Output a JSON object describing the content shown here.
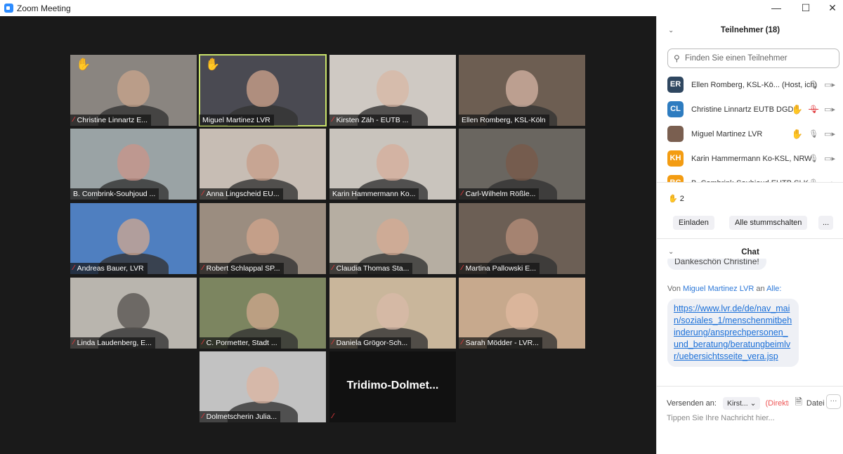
{
  "window": {
    "title": "Zoom Meeting",
    "controls": [
      "—",
      "☐",
      "✕"
    ]
  },
  "tiles": [
    {
      "name": "Christine Linnartz E...",
      "muted": true,
      "hand": true,
      "hand_color": "#a0714f",
      "bg": "#8a8580",
      "skin": "#c9a58c"
    },
    {
      "name": "Miguel Martinez LVR",
      "muted": false,
      "hand": true,
      "hand_color": "#f5c22b",
      "bg": "#4a4a52",
      "skin": "#d1a68e",
      "active": true
    },
    {
      "name": "Kirsten Zäh - EUTB ...",
      "muted": true,
      "bg": "#cfc9c3",
      "skin": "#d8b7a4"
    },
    {
      "name": "Ellen Romberg, KSL-Köln",
      "muted": false,
      "bg": "#6d5e52",
      "skin": "#d7b5a5"
    },
    {
      "name": "B. Combrink-Souhjoud ...",
      "muted": false,
      "bg": "#9aa3a5",
      "skin": "#c9948a"
    },
    {
      "name": "Anna Lingscheid EU...",
      "muted": true,
      "bg": "#c7bdb4",
      "skin": "#c79e88"
    },
    {
      "name": "Karin Hammermann Ko...",
      "muted": false,
      "bg": "#c9c4bd",
      "skin": "#d5ad9b"
    },
    {
      "name": "Carl-Wilhelm Rößle...",
      "muted": true,
      "bg": "#6a6660",
      "skin": "#7a5a48"
    },
    {
      "name": "Andreas Bauer, LVR",
      "muted": true,
      "bg": "#4f7fc0",
      "skin": "#d2a890"
    },
    {
      "name": "Robert Schlappal SP...",
      "muted": true,
      "bg": "#9b8d80",
      "skin": "#d2a58c"
    },
    {
      "name": "Claudia Thomas Sta...",
      "muted": true,
      "bg": "#b6aea2",
      "skin": "#d5aa92"
    },
    {
      "name": "Martina Pallowski E...",
      "muted": true,
      "bg": "#6c5f55",
      "skin": "#b88f7b"
    },
    {
      "name": "Linda Laudenberg, E...",
      "muted": true,
      "bg": "#b9b5ae",
      "skin": "#54504c"
    },
    {
      "name": "C. Pormetter, Stadt ...",
      "muted": true,
      "bg": "#7c8560",
      "skin": "#d0a88e"
    },
    {
      "name": "Daniela Grögor-Sch...",
      "muted": true,
      "bg": "#c9b69b",
      "skin": "#d8b9a8"
    },
    {
      "name": "Sarah Mödder - LVR...",
      "muted": true,
      "bg": "#c7a98d",
      "skin": "#e0b9a0"
    },
    {
      "name": "Dolmetscherin Julia...",
      "muted": true,
      "bg": "#c2c2c2",
      "skin": "#dcb4a0"
    },
    {
      "name": "",
      "big_name": "Tridimo-Dolmet...",
      "muted": true,
      "bg": "#111111"
    }
  ],
  "participants": {
    "title": "Teilnehmer (18)",
    "search_placeholder": "Finden Sie einen Teilnehmer",
    "list": [
      {
        "initials": "ER",
        "color": "#2f4760",
        "name": "Ellen Romberg, KSL-Kö... (Host, ich)",
        "hand": "",
        "mic": "🎙",
        "mic_muted": false
      },
      {
        "initials": "CL",
        "color": "#2e7cc0",
        "name": "Christine Linnartz EUTB DGD",
        "hand": "✋",
        "hand_color": "#a0714f",
        "mic": "🎙",
        "mic_muted": true
      },
      {
        "initials": "",
        "color": "#7a5f50",
        "name": "Miguel Martinez LVR",
        "hand": "✋",
        "hand_color": "#f5c22b",
        "mic": "🎙",
        "mic_muted": false
      },
      {
        "initials": "KH",
        "color": "#f39c12",
        "name": "Karin Hammermann Ko-KSL, NRW",
        "hand": "",
        "mic": "🎙",
        "mic_muted": false
      },
      {
        "initials": "BC",
        "color": "#f39c12",
        "name": "B. Combrink-Souhjoud EUTB SLK",
        "hand": "",
        "mic": "🎙",
        "mic_muted": false
      }
    ],
    "raised_hands": "2",
    "invite_label": "Einladen",
    "mute_all_label": "Alle stummschalten",
    "more_label": "..."
  },
  "chat": {
    "title": "Chat",
    "prev_message": "Dankeschön Christine!",
    "from_prefix": "Von",
    "from_name": "Miguel Martinez LVR",
    "to_word": "an",
    "to_name": "Alle:",
    "link": "https://www.lvr.de/de/nav_main/soziales_1/menschenmitbehinderung/ansprechpersonen_und_beratung/beratungbeimlvr/uebersichtsseite_vera.jsp",
    "send_to_label": "Versenden an:",
    "recipient": "Kirst...",
    "direct_label": "(Direktn",
    "file_label": "Datei",
    "input_placeholder": "Tippen Sie Ihre Nachricht hier..."
  }
}
